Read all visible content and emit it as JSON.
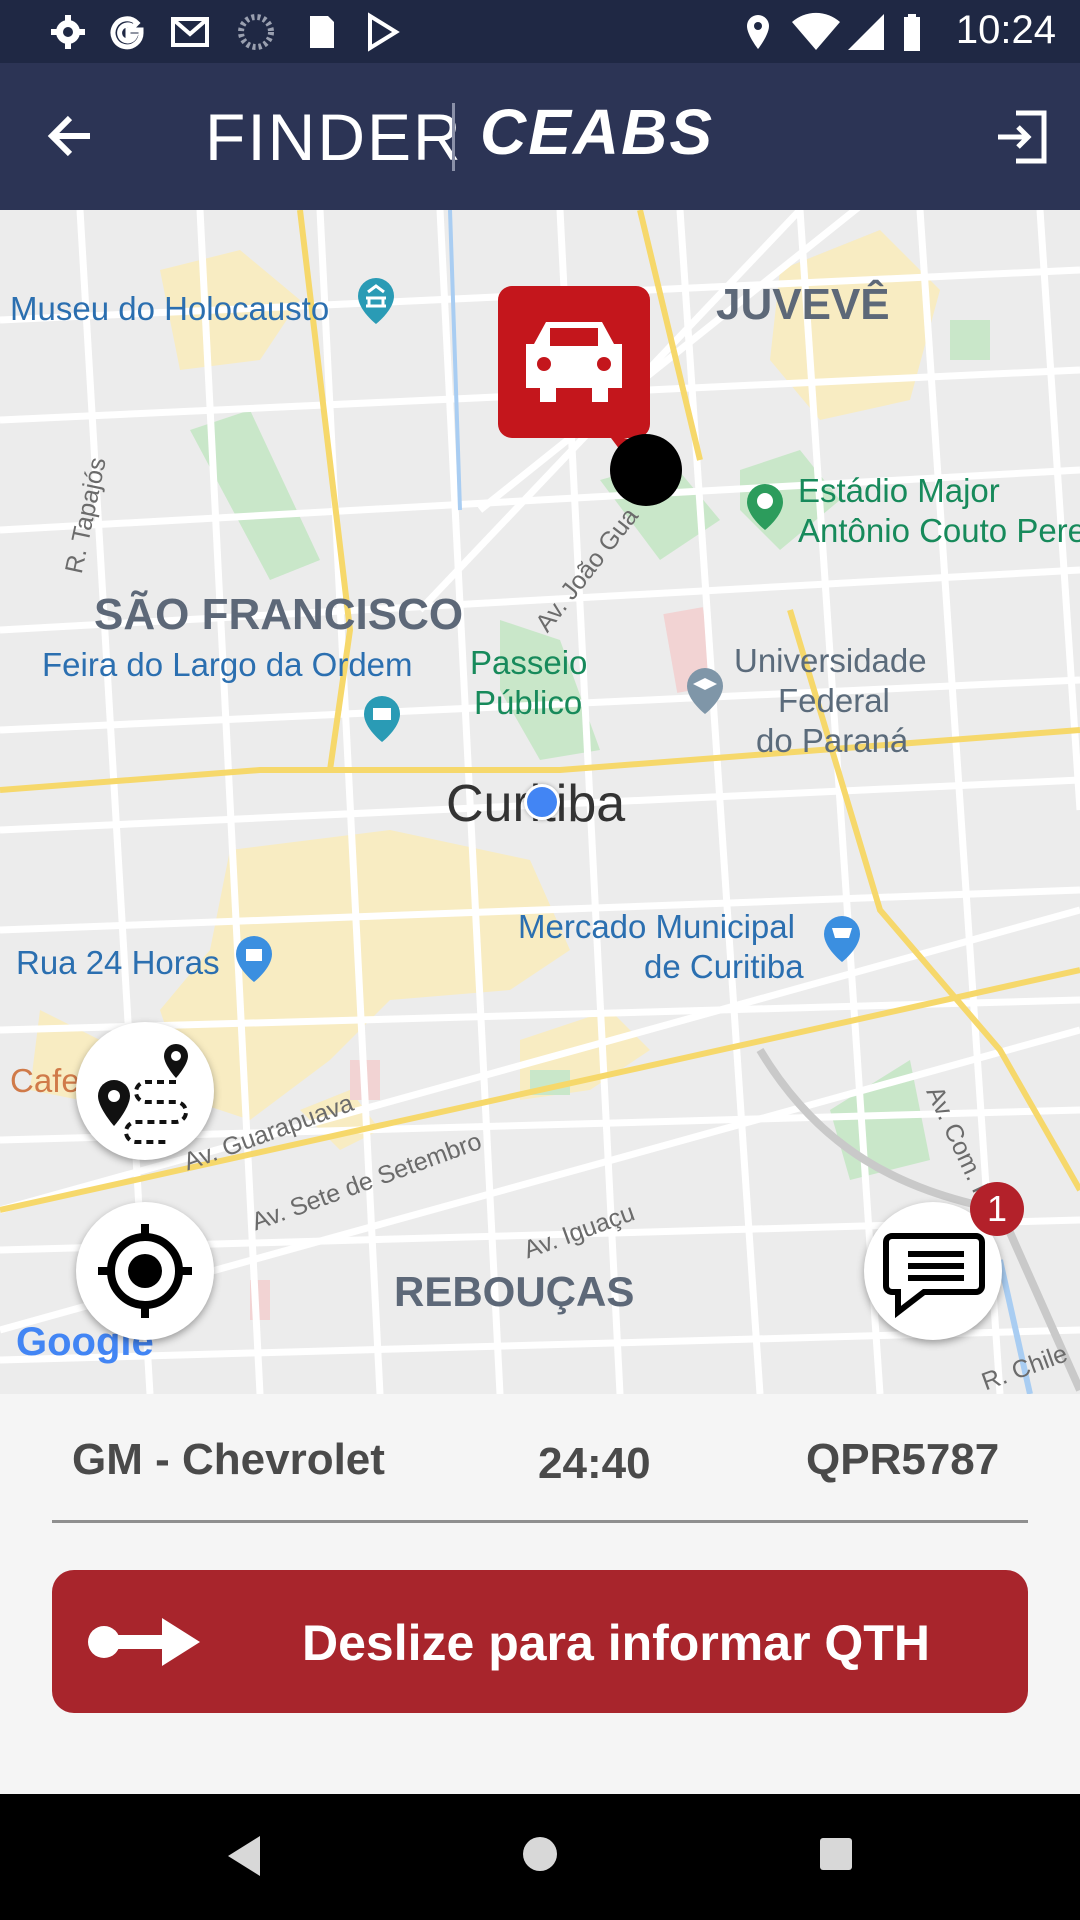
{
  "status_bar": {
    "time": "10:24",
    "icons": [
      "gear-icon",
      "google-icon",
      "gmail-icon",
      "loading-icon",
      "sd-card-icon",
      "play-store-icon",
      "location-icon",
      "wifi-icon",
      "signal-icon",
      "battery-icon"
    ]
  },
  "app_bar": {
    "title": "FINDER",
    "brand": "CEABS"
  },
  "map": {
    "labels": {
      "museu": "Museu do Holocausto",
      "juveve": "JUVEVÊ",
      "estadio_1": "Estádio Major",
      "estadio_2": "Antônio Couto Pere",
      "r_tapajos": "R. Tapajós",
      "av_joao": "Av. João Gua",
      "sao_francisco": "SÃO FRANCISCO",
      "feira": "Feira do Largo da Ordem",
      "passeio_1": "Passeio",
      "passeio_2": "Público",
      "ufpr_1": "Universidade",
      "ufpr_2": "Federal",
      "ufpr_3": "do Paraná",
      "curitiba": "Curitiba",
      "mercado_1": "Mercado Municipal",
      "mercado_2": "de Curitiba",
      "rua24": "Rua 24 Horas",
      "cafe": "Cafe",
      "av_guarapuava": "Av. Guarapuava",
      "av_sete": "Av. Sete de Setembro",
      "av_iguacu": "Av. Iguaçu",
      "av_com": "Av. Com. Fr",
      "reboucas": "REBOUÇAS",
      "r_chile": "R. Chile",
      "google": "Google"
    },
    "chat_badge": "1"
  },
  "vehicle": {
    "make": "GM - Chevrolet",
    "time": "24:40",
    "plate": "QPR5787"
  },
  "slide_button": {
    "label": "Deslize para informar QTH"
  },
  "colors": {
    "header": "#2c3455",
    "status_bar": "#1f2844",
    "accent_red": "#a8252c",
    "marker_red": "#c4161c"
  }
}
